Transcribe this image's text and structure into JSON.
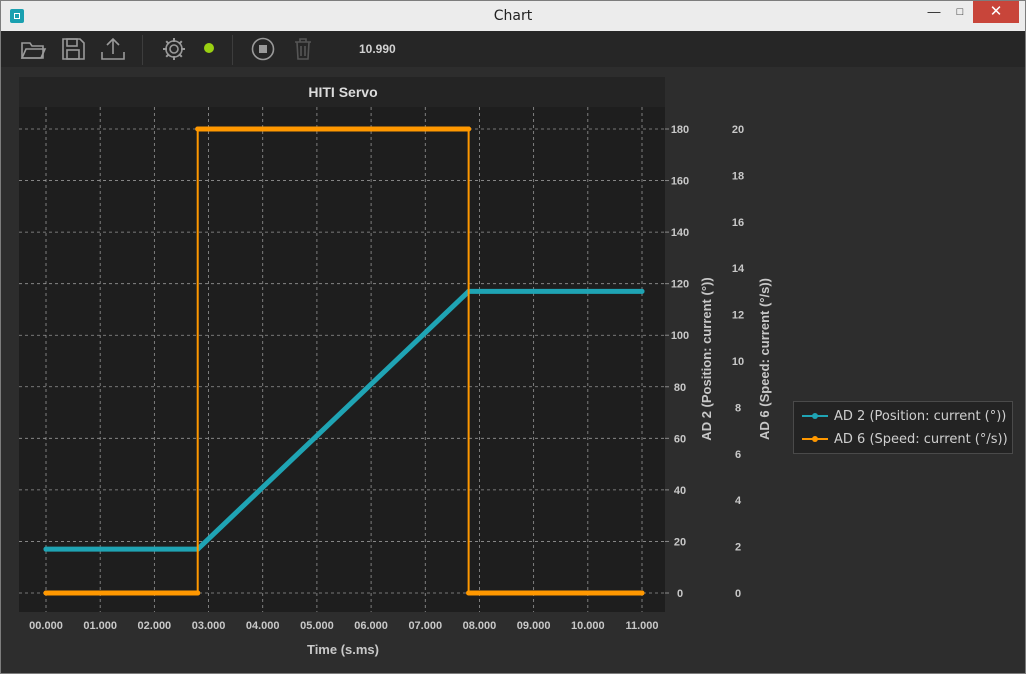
{
  "window": {
    "title": "Chart"
  },
  "toolbar": {
    "value": "10.990",
    "status_color": "#9ad012"
  },
  "colors": {
    "position": "#1fa4b4",
    "speed": "#ff9800",
    "plot_bg": "#1e1e1e",
    "grid": "#bdbdbd"
  },
  "chart_data": {
    "type": "line",
    "title": "HITI Servo",
    "xlabel": "Time (s.ms)",
    "ylabel_left": "AD 2 (Position: current (°))",
    "ylabel_right": "AD 6 (Speed: current (°/s))",
    "x_ticks": [
      "00.000",
      "01.000",
      "02.000",
      "03.000",
      "04.000",
      "05.000",
      "06.000",
      "07.000",
      "08.000",
      "09.000",
      "10.000",
      "11.000"
    ],
    "xlim": [
      0,
      11
    ],
    "y_left_ticks": [
      "0",
      "20",
      "40",
      "60",
      "80",
      "100",
      "120",
      "140",
      "160",
      "180"
    ],
    "y_left_lim": [
      0,
      180
    ],
    "y_right_ticks": [
      "0",
      "2",
      "4",
      "6",
      "8",
      "10",
      "12",
      "14",
      "16",
      "18",
      "20"
    ],
    "y_right_lim": [
      0,
      20
    ],
    "grid": true,
    "legend_position": "right",
    "series": [
      {
        "name": "AD 2 (Position: current (°))",
        "axis": "left",
        "color": "#1fa4b4",
        "x": [
          0,
          2.8,
          7.8,
          11
        ],
        "y": [
          17,
          17,
          117,
          117
        ]
      },
      {
        "name": "AD 6 (Speed: current (°/s))",
        "axis": "right",
        "color": "#ff9800",
        "x": [
          0,
          2.8,
          2.8,
          7.8,
          7.8,
          11
        ],
        "y": [
          0,
          0,
          20,
          20,
          0,
          0
        ]
      }
    ]
  }
}
